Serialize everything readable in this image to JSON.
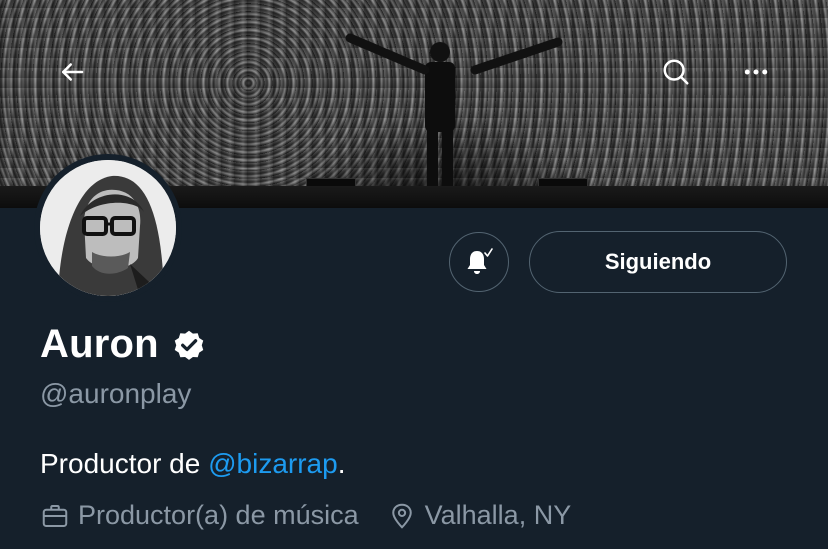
{
  "header": {
    "back_icon": "arrow-left-icon",
    "search_icon": "search-icon",
    "more_icon": "more-horizontal-icon"
  },
  "profile": {
    "display_name": "Auron",
    "handle": "@auronplay",
    "verified": true,
    "bio_prefix": "Productor de ",
    "bio_mention": "@bizarrap",
    "bio_suffix": ".",
    "profession": "Productor(a) de música",
    "location": "Valhalla, NY"
  },
  "actions": {
    "notifications_icon": "bell-subscribed-icon",
    "follow_label": "Siguiendo"
  },
  "colors": {
    "background": "#15202b",
    "mention": "#1d9bf0",
    "secondary_text": "#8b98a5",
    "button_border": "#536471"
  }
}
